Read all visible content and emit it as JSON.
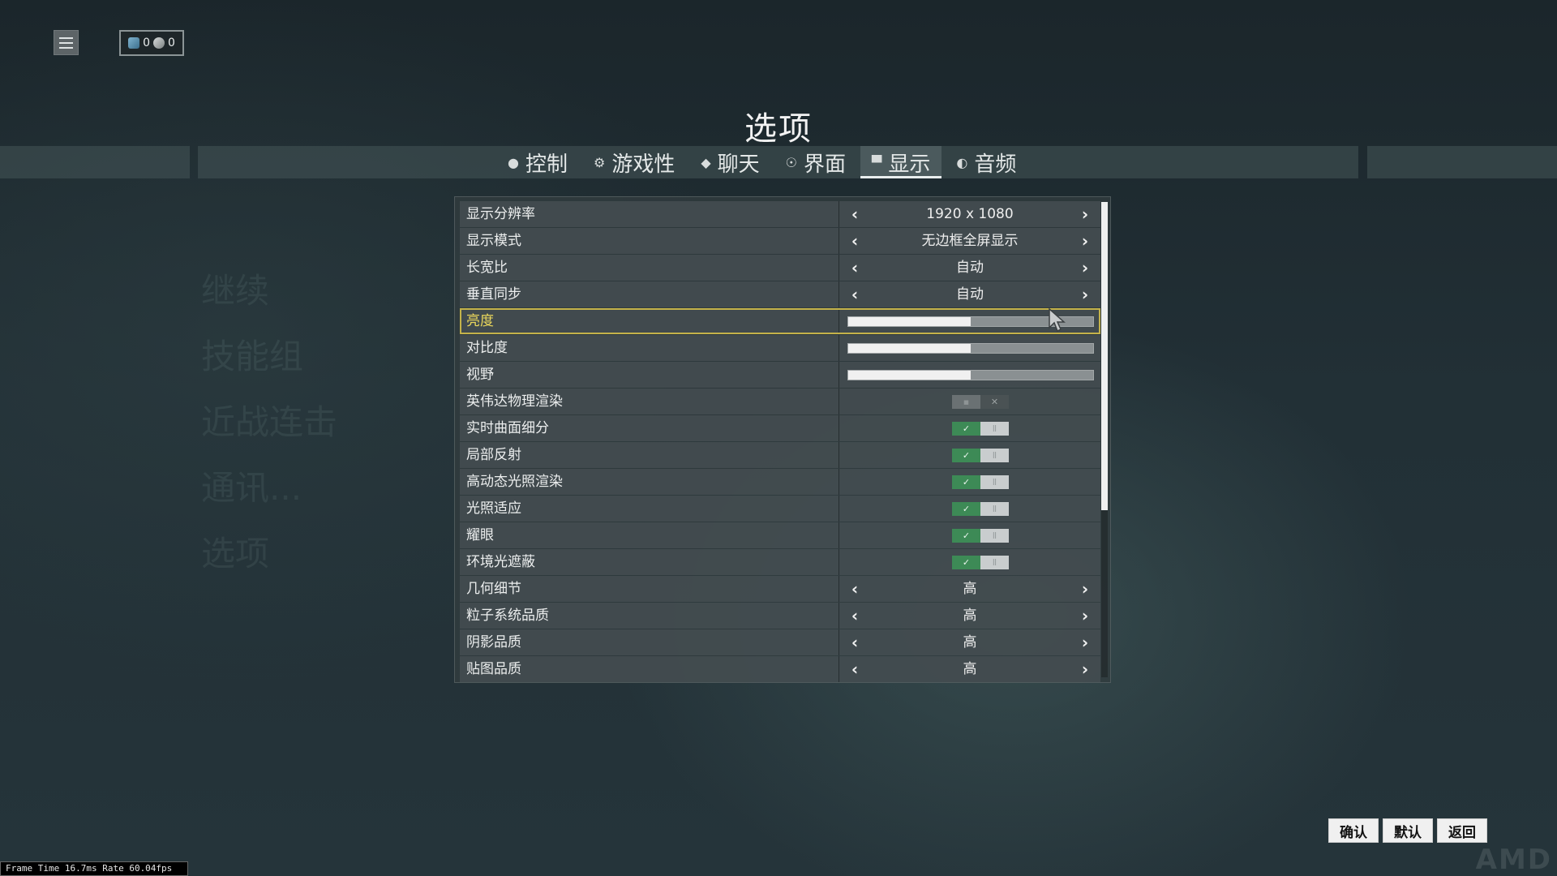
{
  "header": {
    "currency": [
      {
        "icon": "platinum-icon",
        "value": "0"
      },
      {
        "icon": "credits-icon",
        "value": "0"
      }
    ]
  },
  "ghost_menu": [
    "继续",
    "技能组",
    "近战连击",
    "通讯...",
    "选项"
  ],
  "title": "选项",
  "tabs": [
    {
      "id": "controls",
      "label": "控制",
      "icon": "mouse-icon",
      "glyph": "●"
    },
    {
      "id": "gameplay",
      "label": "游戏性",
      "icon": "gear-icon",
      "glyph": "⚙"
    },
    {
      "id": "chat",
      "label": "聊天",
      "icon": "chat-icon",
      "glyph": "◆"
    },
    {
      "id": "interface",
      "label": "界面",
      "icon": "interface-icon",
      "glyph": "☉"
    },
    {
      "id": "display",
      "label": "显示",
      "icon": "monitor-icon",
      "glyph": "▀",
      "active": true
    },
    {
      "id": "audio",
      "label": "音频",
      "icon": "speaker-icon",
      "glyph": "◐"
    }
  ],
  "settings": [
    {
      "label": "显示分辨率",
      "type": "select",
      "value": "1920 x 1080"
    },
    {
      "label": "显示模式",
      "type": "select",
      "value": "无边框全屏显示"
    },
    {
      "label": "长宽比",
      "type": "select",
      "value": "自动"
    },
    {
      "label": "垂直同步",
      "type": "select",
      "value": "自动"
    },
    {
      "label": "亮度",
      "type": "slider",
      "value": 0.5,
      "highlight": true
    },
    {
      "label": "对比度",
      "type": "slider",
      "value": 0.5
    },
    {
      "label": "视野",
      "type": "slider",
      "value": 0.5
    },
    {
      "label": "英伟达物理渲染",
      "type": "toggle",
      "value": false
    },
    {
      "label": "实时曲面细分",
      "type": "toggle",
      "value": true
    },
    {
      "label": "局部反射",
      "type": "toggle",
      "value": true
    },
    {
      "label": "高动态光照渲染",
      "type": "toggle",
      "value": true
    },
    {
      "label": "光照适应",
      "type": "toggle",
      "value": true
    },
    {
      "label": "耀眼",
      "type": "toggle",
      "value": true
    },
    {
      "label": "环境光遮蔽",
      "type": "toggle",
      "value": true
    },
    {
      "label": "几何细节",
      "type": "select",
      "value": "高"
    },
    {
      "label": "粒子系统品质",
      "type": "select",
      "value": "高"
    },
    {
      "label": "阴影品质",
      "type": "select",
      "value": "高"
    },
    {
      "label": "贴图品质",
      "type": "select",
      "value": "高"
    }
  ],
  "buttons": {
    "confirm": "确认",
    "default": "默认",
    "back": "返回"
  },
  "perf": "Frame Time 16.7ms Rate 60.04fps",
  "watermark": "AMD"
}
